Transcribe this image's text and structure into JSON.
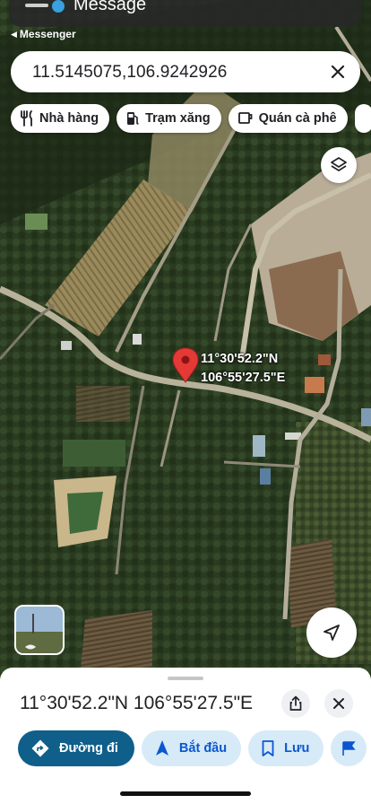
{
  "status": {
    "notification_title": "Message",
    "back_app_label": "Messenger"
  },
  "search": {
    "value": "11.5145075,106.9242926"
  },
  "chips": [
    {
      "label": "Nhà hàng",
      "icon": "fork-knife-icon"
    },
    {
      "label": "Trạm xăng",
      "icon": "gas-station-icon"
    },
    {
      "label": "Quán cà phê",
      "icon": "coffee-icon"
    }
  ],
  "pin": {
    "lat_label": "11°30'52.2\"N",
    "lng_label": "106°55'27.5\"E",
    "color": "#e53935"
  },
  "sheet": {
    "title": "11°30'52.2\"N 106°55'27.5\"E",
    "actions": [
      {
        "label": "Đường đi",
        "icon": "directions-icon"
      },
      {
        "label": "Bắt đầu",
        "icon": "navigation-arrow-icon"
      },
      {
        "label": "Lưu",
        "icon": "bookmark-icon"
      }
    ]
  },
  "colors": {
    "primary_action": "#0f5f8a",
    "secondary_action_bg": "#d7eaf8",
    "secondary_action_text": "#0b57d0"
  }
}
